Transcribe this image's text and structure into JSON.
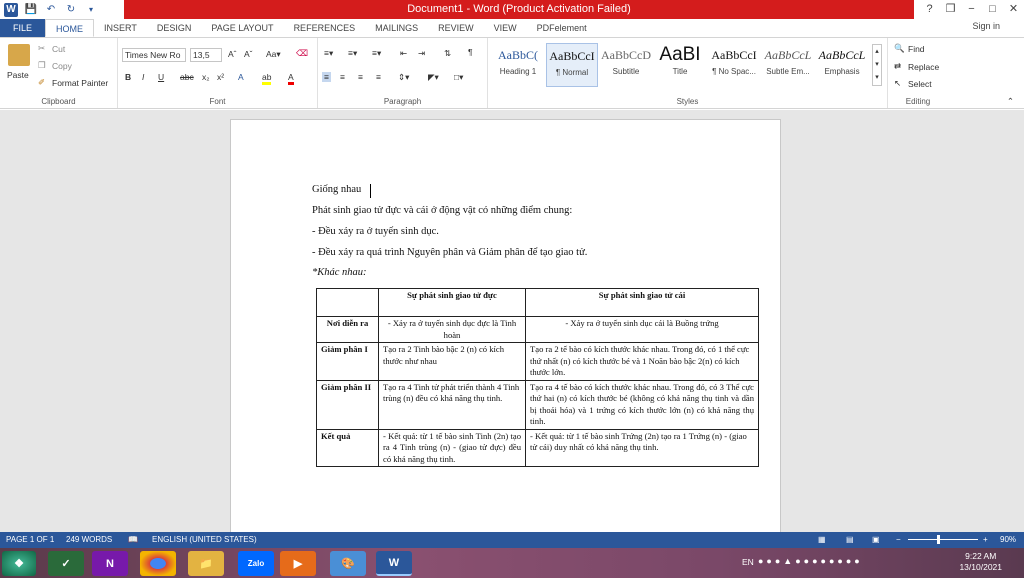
{
  "window": {
    "title": "Document1 - Word (Product Activation Failed)",
    "help": "?",
    "restore": "❒",
    "minimize": "−",
    "maximize": "□",
    "close": "✕"
  },
  "tabs": [
    "FILE",
    "HOME",
    "INSERT",
    "DESIGN",
    "PAGE LAYOUT",
    "REFERENCES",
    "MAILINGS",
    "REVIEW",
    "VIEW",
    "PDFelement"
  ],
  "signin": "Sign in",
  "clipboard": {
    "paste": "Paste",
    "cut": "Cut",
    "copy": "Copy",
    "format_painter": "Format Painter",
    "label": "Clipboard"
  },
  "font": {
    "name": "Times New Ro",
    "size": "13,5",
    "label": "Font"
  },
  "paragraph": {
    "label": "Paragraph"
  },
  "styles": {
    "label": "Styles",
    "items": [
      {
        "preview": "AaBbC(",
        "name": "Heading 1"
      },
      {
        "preview": "AaBbCcI",
        "name": "¶ Normal"
      },
      {
        "preview": "AaBbCcD",
        "name": "Subtitle"
      },
      {
        "preview": "AaBI",
        "name": "Title"
      },
      {
        "preview": "AaBbCcI",
        "name": "¶ No Spac..."
      },
      {
        "preview": "AaBbCcL",
        "name": "Subtle Em..."
      },
      {
        "preview": "AaBbCcL",
        "name": "Emphasis"
      }
    ]
  },
  "editing": {
    "find": "Find",
    "replace": "Replace",
    "select": "Select",
    "label": "Editing"
  },
  "doc": {
    "line1": "Giống nhau",
    "line2": "Phát sinh giao tử đực và cái ở động vật có những điểm chung:",
    "line3": "-   Đều xảy ra ở tuyến sinh dục.",
    "line4": "-   Đều xảy ra quá trình Nguyên phân và Giảm phân để tạo giao tử.",
    "line5": "*Khác nhau:",
    "table": {
      "headers": [
        "",
        "Sự phát sinh giao tử đực",
        "Sự phát sinh giao tử cái"
      ],
      "rows": [
        [
          "Nơi diễn ra",
          "- Xảy ra ở tuyến sinh dục đực là Tinh hoàn",
          "- Xảy ra ở tuyến sinh dục cái là Buồng trứng"
        ],
        [
          "Giảm phân I",
          "Tạo ra 2 Tinh bào bậc 2 (n) có kích thước như nhau",
          "Tạo ra 2 tế bào có kích thước khác nhau. Trong đó, có 1 thể cực thứ  nhất (n) có kích thước bé và 1 Noãn bào bậc 2(n) có kích thước lớn."
        ],
        [
          "Giảm phân II",
          "Tạo ra 4 Tinh tử phát triển thành 4 Tinh trùng (n) đều có khả năng thụ tinh.",
          "Tạo ra 4 tế bào có kích thước khác nhau. Trong đó, có 3 Thể cực thứ hai (n) có kích thước bé (không có khả năng thụ tinh và dần bị thoái hóa) và 1 trứng có kích thước lớn (n) có khả năng thụ tinh."
        ],
        [
          "Kết quả",
          "- Kết quả: từ 1 tế bào sinh Tinh (2n) tạo ra  4 Tinh trùng (n) - (giao tử đực) đều có khả năng thụ tinh.",
          "- Kết quả: từ 1 tế bào sinh Trứng (2n) tạo ra  1 Trứng (n) - (giao tử cái) duy nhất có khả năng thụ tinh."
        ]
      ]
    }
  },
  "status": {
    "page": "PAGE 1 OF 1",
    "words": "249 WORDS",
    "language": "ENGLISH (UNITED STATES)",
    "zoom": "90%"
  },
  "taskbar": {
    "lang": "EN",
    "time": "9:22 AM",
    "date": "13/10/2021"
  },
  "accent": "#2b579a"
}
